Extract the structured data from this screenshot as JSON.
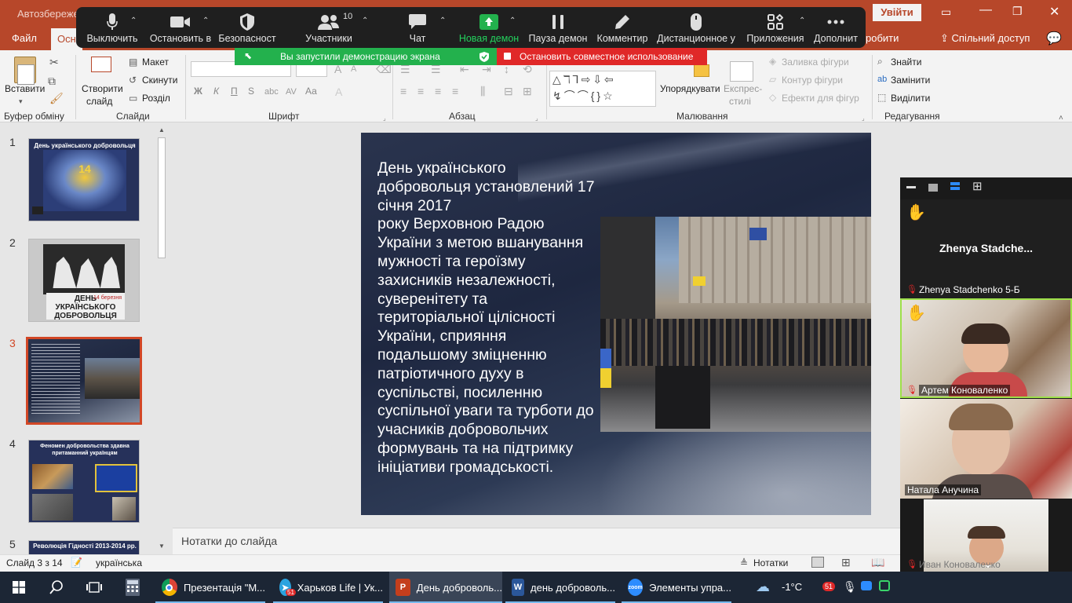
{
  "ppt": {
    "autosave": "Автозбереження",
    "sign_in": "Увійти",
    "tabs": [
      "Файл",
      "Осн"
    ],
    "tab_right": "робити",
    "share": "Спільний доступ"
  },
  "zoom": {
    "buttons": [
      {
        "label": "Выключить",
        "icon": "microphone-icon"
      },
      {
        "label": "Остановить в",
        "icon": "video-camera-icon"
      },
      {
        "label": "Безопасност",
        "icon": "shield-icon"
      },
      {
        "label": "Участники",
        "icon": "participants-icon",
        "count": "10"
      },
      {
        "label": "Чат",
        "icon": "chat-icon"
      },
      {
        "label": "Новая демон",
        "icon": "share-screen-icon"
      },
      {
        "label": "Пауза демон",
        "icon": "pause-icon"
      },
      {
        "label": "Комментир",
        "icon": "pen-icon"
      },
      {
        "label": "Дистанционное у",
        "icon": "mouse-icon"
      },
      {
        "label": "Приложения",
        "icon": "apps-icon"
      },
      {
        "label": "Дополнит",
        "icon": "more-icon"
      }
    ],
    "share_banner": "Вы запустили демонстрацию экрана",
    "stop_banner": "Остановить совместное использование",
    "accent_green": "#23b14d",
    "accent_red": "#e02828"
  },
  "ribbon": {
    "paste": "Вставити",
    "clipboard": "Буфер обміну",
    "new_slide_1": "Створити",
    "new_slide_2": "слайд",
    "layout": "Макет",
    "reset": "Скинути",
    "section": "Розділ",
    "slides_group": "Слайди",
    "font_group": "Шрифт",
    "bold": "Ж",
    "italic": "К",
    "underline": "П",
    "strike": "S",
    "aa": "Аа",
    "paragraph_group": "Абзац",
    "arrange": "Упорядкувати",
    "quick_styles_1": "Експрес-",
    "quick_styles_2": "стилі",
    "shape_fill": "Заливка фігури",
    "shape_outline": "Контур фігури",
    "shape_effects": "Ефекти для фігур",
    "drawing_group": "Малювання",
    "find": "Знайти",
    "replace": "Замінити",
    "select": "Виділити",
    "editing_group": "Редагування"
  },
  "thumbnails": [
    {
      "num": "1",
      "title": "День українського добровольця"
    },
    {
      "num": "2",
      "title": "ДЕНЬ УКРАЇНСЬКОГО ДОБРОВОЛЬЦЯ",
      "date": "14 березня"
    },
    {
      "num": "3",
      "title": ""
    },
    {
      "num": "4",
      "title": "Феномен добровольства здавна притаманний українцям"
    },
    {
      "num": "5",
      "title": "Революція Гідності 2013-2014 рр."
    }
  ],
  "slide": {
    "text": "День українського добровольця установлений 17 січня 2017\nроку Верховною Радою України з метою вшанування мужності та героїзму захисників незалежності, суверенітету та територіальної цілісності України, сприяння подальшому зміцненню патріотичного духу в суспільстві, посиленню суспільної уваги та турботи до учасників добровольчих формувань та на підтримку ініціативи громадськості."
  },
  "notes": "Нотатки до слайда",
  "status": {
    "slide_counter": "Слайд 3 з 14",
    "language": "українська",
    "notes_btn": "Нотатки"
  },
  "gallery": {
    "tiles": [
      {
        "name": "Zhenya  Stadche...",
        "label": "Zhenya Stadchenko 5-Б",
        "muted": true,
        "hand": true
      },
      {
        "name": "Артем Коноваленко",
        "muted": true,
        "hand": true
      },
      {
        "name": "Натала Анучина",
        "muted": false,
        "hand": false
      },
      {
        "name": "Иван Коноваленко",
        "muted": true,
        "hand": false
      }
    ]
  },
  "taskbar": {
    "apps": [
      {
        "label": "Презентація \"М...",
        "icon": "chrome-icon"
      },
      {
        "label": "Харьков Life | Ук...",
        "icon": "telegram-icon",
        "badge": "51"
      },
      {
        "label": "День доброволь...",
        "icon": "powerpoint-icon"
      },
      {
        "label": "день доброволь...",
        "icon": "word-icon"
      },
      {
        "label": "Элементы упра...",
        "icon": "zoom-icon"
      }
    ],
    "temp": "-1°C",
    "tray_badge": "51"
  }
}
